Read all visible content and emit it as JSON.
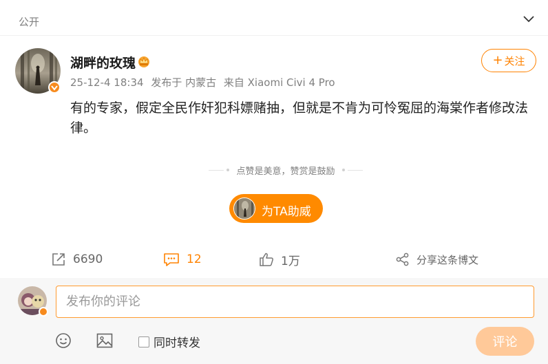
{
  "visibility": {
    "label": "公开",
    "icon": "chevron-down-icon"
  },
  "author": {
    "name": "湖畔的玫瑰",
    "badge_icon": "crown-icon",
    "verified_icon": "verified-icon"
  },
  "follow_button": {
    "plus": "+",
    "label": "关注"
  },
  "post": {
    "date": "25-12-4 18:34",
    "location": "发布于 内蒙古",
    "source": "来自 Xiaomi Civi 4 Pro",
    "content": "有的专家，假定全民作奸犯科嫖赌抽，但就是不肯为可怜冤屈的海棠作者修改法律。"
  },
  "reward": {
    "text": "点赞是美意，赞赏是鼓励",
    "button_label": "为TA助威"
  },
  "actions": {
    "repost": {
      "icon": "repost-icon",
      "count": "6690"
    },
    "comment": {
      "icon": "comment-icon",
      "count": "12"
    },
    "like": {
      "icon": "like-icon",
      "count": "1万"
    },
    "share": {
      "icon": "share-icon",
      "label": "分享这条博文"
    }
  },
  "comment_box": {
    "placeholder": "发布你的评论",
    "repost_option": "同时转发",
    "submit_label": "评论",
    "emoji_icon": "emoji-icon",
    "image_icon": "image-icon"
  },
  "colors": {
    "accent": "#ff8200",
    "submit_disabled": "#ffc999",
    "muted_text": "#808080"
  }
}
